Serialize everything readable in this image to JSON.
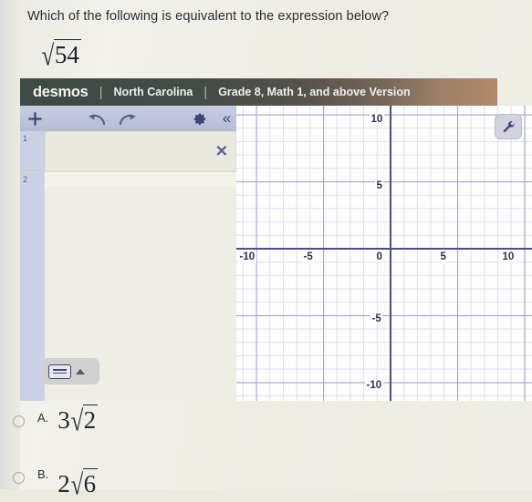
{
  "question": {
    "prompt": "Which of the following is equivalent to the expression below?",
    "expression": {
      "sign": "√",
      "radicand": "54"
    }
  },
  "desmos": {
    "logo": "desmos",
    "separator": "|",
    "state": "North Carolina",
    "version": "Grade 8, Math 1, and above Version",
    "toolbar": {
      "add": "+",
      "undo": "undo-arrow",
      "redo": "redo-arrow",
      "settings": "gear",
      "collapse": "«"
    },
    "expressions": [
      {
        "index": "1",
        "value": "",
        "active": true,
        "delete_label": "✕"
      },
      {
        "index": "2",
        "value": "",
        "active": false
      }
    ],
    "keyboard_toggle": {
      "icon": "keyboard-icon",
      "caret": "caret-up-icon"
    },
    "graph_tools": {
      "wrench": "wrench-icon"
    }
  },
  "chart_data": {
    "type": "scatter",
    "title": "",
    "xlabel": "",
    "ylabel": "",
    "xlim": [
      -10,
      10
    ],
    "ylim": [
      -10,
      10
    ],
    "xticks": [
      "-10",
      "-5",
      "0",
      "5",
      "10"
    ],
    "yticks": [
      "10",
      "5",
      "0",
      "-5",
      "-10"
    ],
    "grid": true,
    "minor_grid_step": 1,
    "major_grid_step": 5,
    "legend": "none",
    "series": []
  },
  "answers": [
    {
      "letter": "A.",
      "coefficient": "3",
      "sign": "√",
      "radicand": "2",
      "selected": false
    },
    {
      "letter": "B.",
      "coefficient": "2",
      "sign": "√",
      "radicand": "6",
      "selected": false
    }
  ]
}
